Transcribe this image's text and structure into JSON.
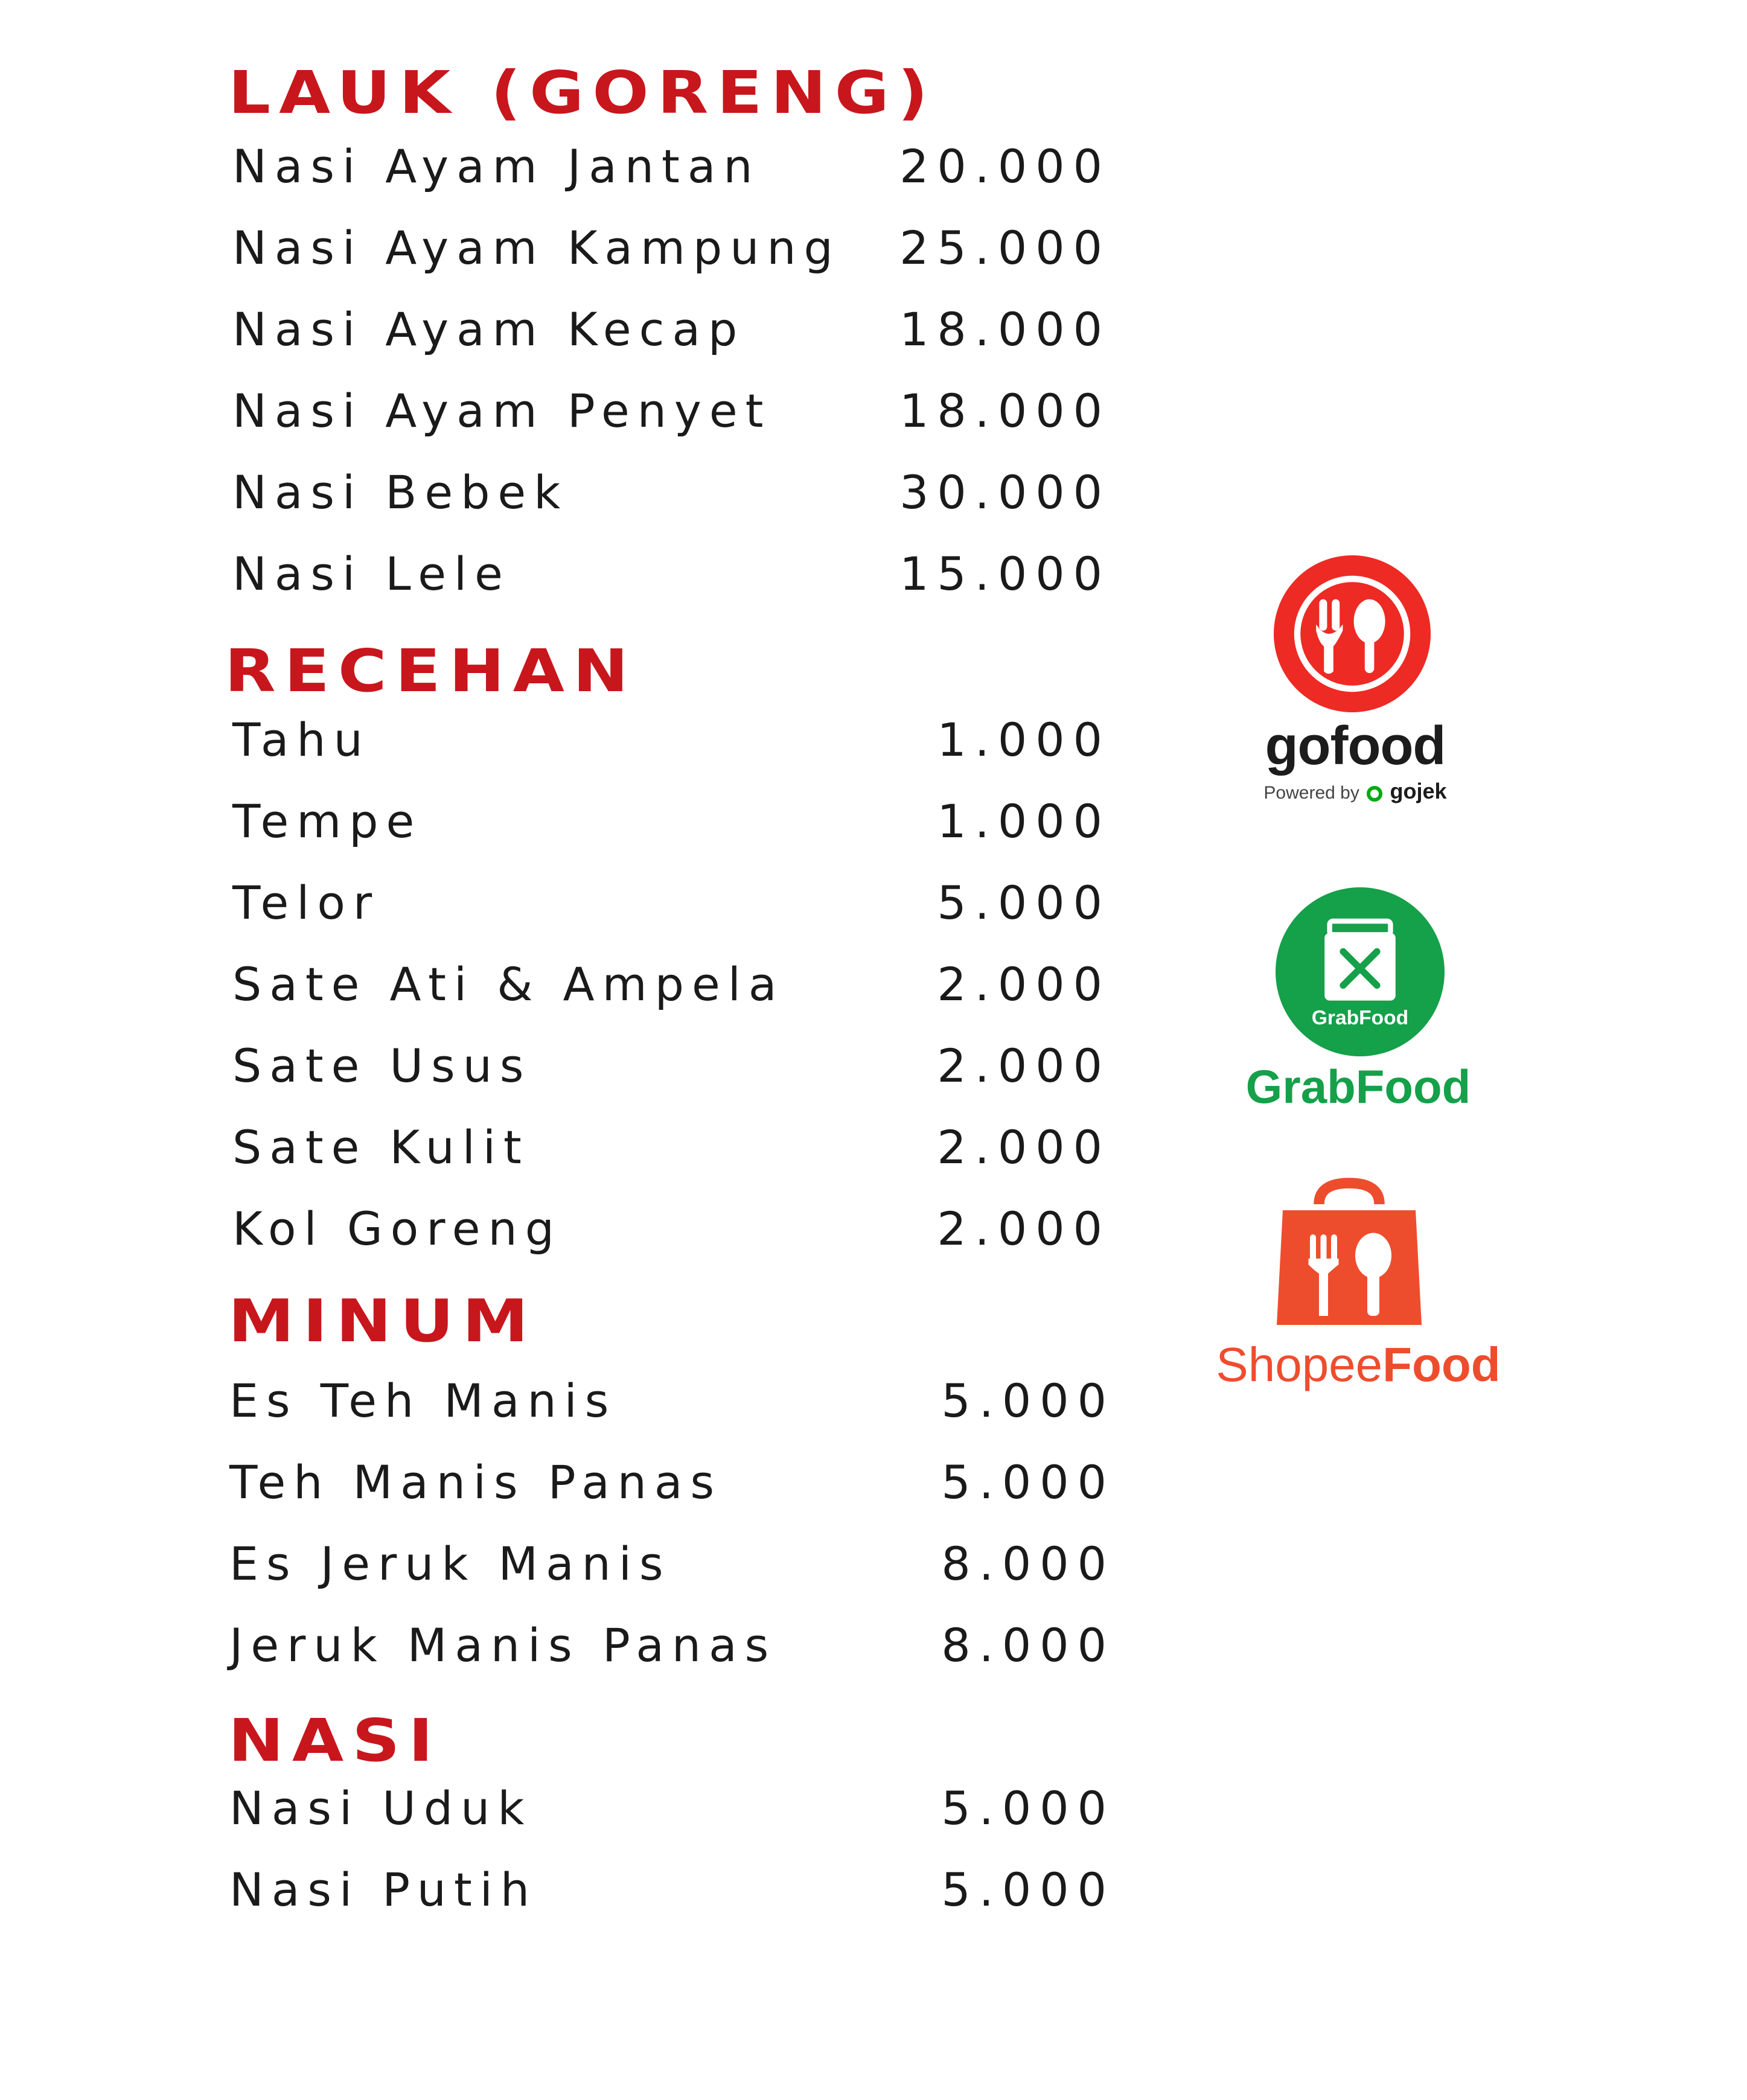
{
  "sections": [
    {
      "title": "LAUK (GORENG)",
      "items": [
        {
          "name": "Nasi Ayam Jantan",
          "price": "20.000"
        },
        {
          "name": "Nasi Ayam Kampung",
          "price": "25.000"
        },
        {
          "name": "Nasi Ayam Kecap",
          "price": "18.000"
        },
        {
          "name": "Nasi Ayam Penyet",
          "price": "18.000"
        },
        {
          "name": "Nasi Bebek",
          "price": "30.000"
        },
        {
          "name": "Nasi Lele",
          "price": "15.000"
        }
      ]
    },
    {
      "title": "RECEHAN",
      "items": [
        {
          "name": "Tahu",
          "price": "1.000"
        },
        {
          "name": "Tempe",
          "price": "1.000"
        },
        {
          "name": "Telor",
          "price": "5.000"
        },
        {
          "name": "Sate Ati & Ampela",
          "price": "2.000"
        },
        {
          "name": "Sate Usus",
          "price": "2.000"
        },
        {
          "name": "Sate Kulit",
          "price": "2.000"
        },
        {
          "name": "Kol Goreng",
          "price": "2.000"
        }
      ]
    },
    {
      "title": "MINUM",
      "items": [
        {
          "name": "Es Teh Manis",
          "price": "5.000"
        },
        {
          "name": "Teh Manis Panas",
          "price": "5.000"
        },
        {
          "name": "Es Jeruk Manis",
          "price": "8.000"
        },
        {
          "name": "Jeruk Manis Panas",
          "price": "8.000"
        }
      ]
    },
    {
      "title": "NASI",
      "items": [
        {
          "name": "Nasi Uduk",
          "price": "5.000"
        },
        {
          "name": "Nasi Putih",
          "price": "5.000"
        }
      ]
    }
  ],
  "delivery_partners": {
    "gofood": {
      "wordmark": "gofood",
      "powered_prefix": "Powered by",
      "powered_brand": "gojek",
      "color": "#ee2a24",
      "icon": "fork-spoon-icon"
    },
    "grabfood": {
      "badge_text": "GrabFood",
      "wordmark": "GrabFood",
      "color": "#00a54f",
      "icon": "bag-fork-knife-icon"
    },
    "shopeefood": {
      "wordmark_light": "Shopee",
      "wordmark_bold": "Food",
      "color": "#ee4d2d",
      "icon": "bag-fork-spoon-icon"
    }
  },
  "colors": {
    "heading": "#c8161d",
    "text": "#1a1a1a",
    "background": "#ffffff"
  }
}
